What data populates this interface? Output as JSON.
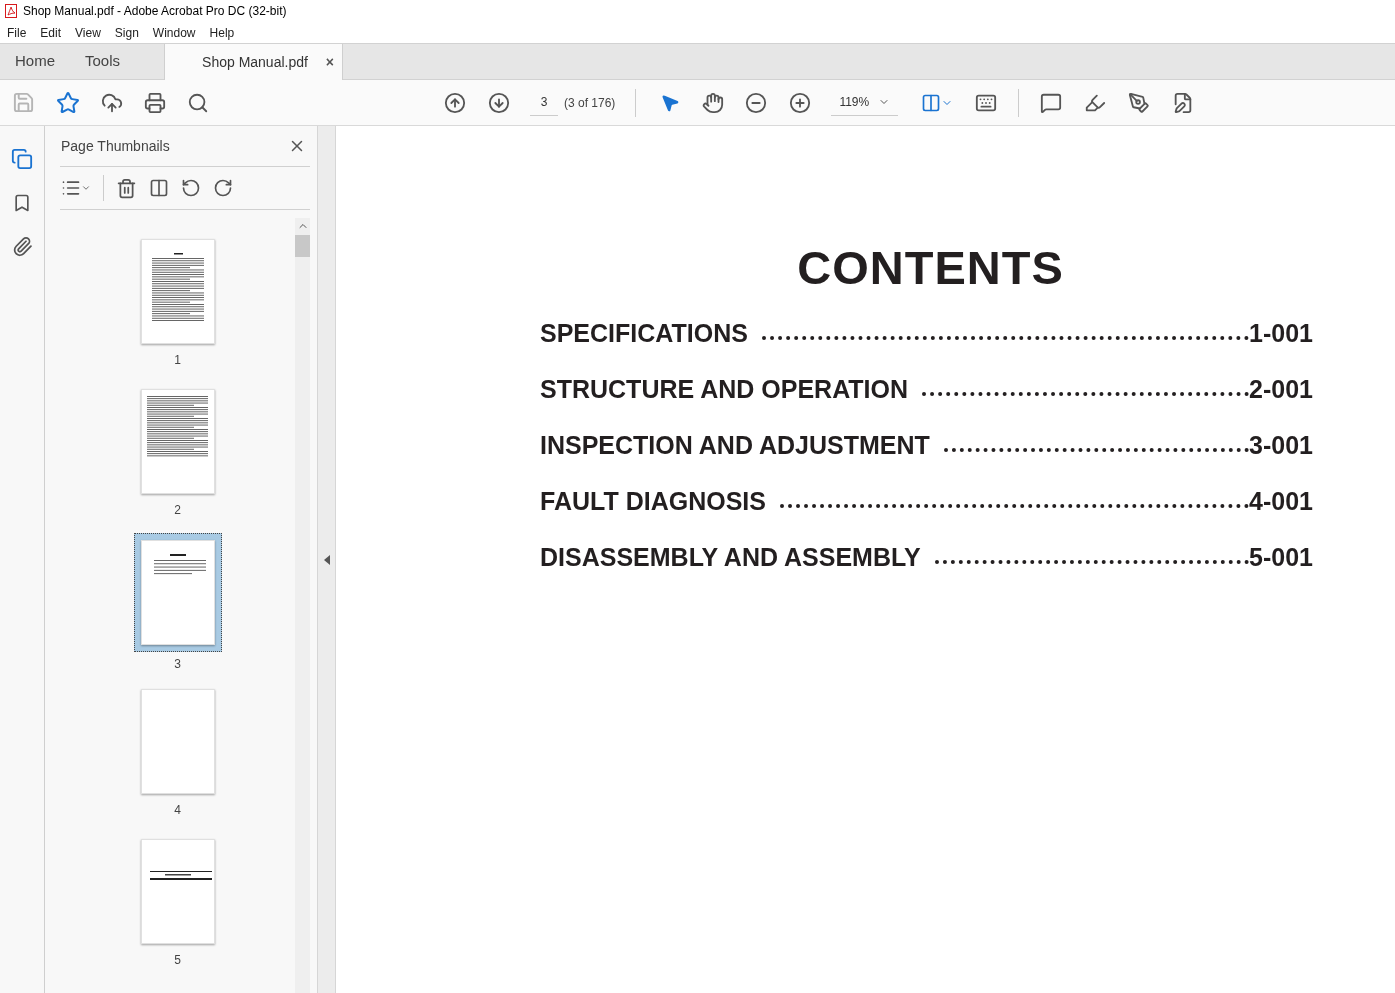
{
  "window": {
    "title": "Shop Manual.pdf - Adobe Acrobat Pro DC (32-bit)"
  },
  "menu": [
    "File",
    "Edit",
    "View",
    "Sign",
    "Window",
    "Help"
  ],
  "tabs": [
    {
      "label": "Home",
      "selected": false,
      "kind": "nav"
    },
    {
      "label": "Tools",
      "selected": false,
      "kind": "nav"
    },
    {
      "label": "Shop Manual.pdf",
      "selected": true,
      "kind": "document",
      "close": "×"
    }
  ],
  "toolbar": {
    "page": "3",
    "page_count": "(3 of 176)",
    "zoom": "119%"
  },
  "thumbnail_panel": {
    "title": "Page Thumbnails",
    "thumbnails": [
      {
        "label": "1",
        "kind": "text",
        "selected": false
      },
      {
        "label": "2",
        "kind": "dense",
        "selected": false
      },
      {
        "label": "3",
        "kind": "contents",
        "selected": true
      },
      {
        "label": "4",
        "kind": "blank",
        "selected": false
      },
      {
        "label": "5",
        "kind": "section",
        "selected": false
      }
    ]
  },
  "document": {
    "heading": "CONTENTS",
    "entries": [
      {
        "title": "SPECIFICATIONS",
        "page": "1-001"
      },
      {
        "title": "STRUCTURE AND OPERATION",
        "page": "2-001"
      },
      {
        "title": "INSPECTION AND ADJUSTMENT",
        "page": "3-001"
      },
      {
        "title": "FAULT DIAGNOSIS",
        "page": "4-001"
      },
      {
        "title": "DISASSEMBLY AND ASSEMBLY",
        "page": "5-001"
      }
    ]
  }
}
